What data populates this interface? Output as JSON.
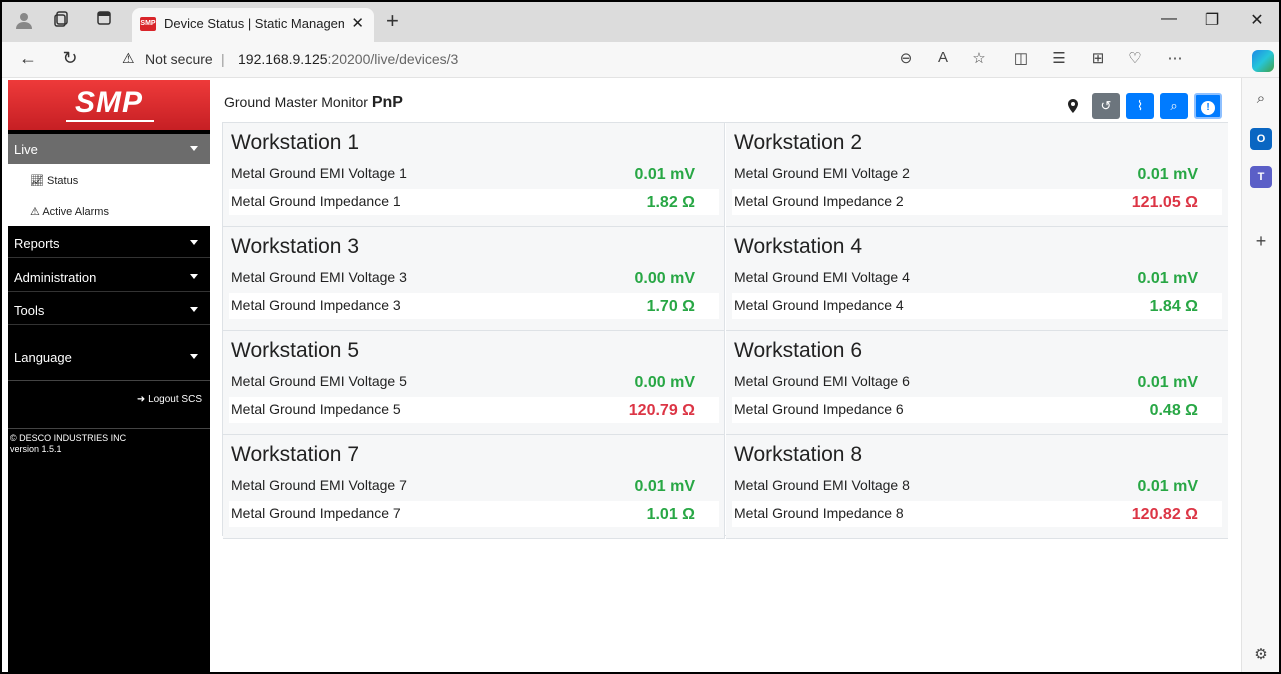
{
  "browser": {
    "tab_title": "Device Status | Static Managemen",
    "tab_close": "✕",
    "new_tab": "+",
    "not_secure": "Not secure",
    "url_host": "192.168.9.125",
    "url_path": ":20200/live/devices/3",
    "window_controls": [
      "—",
      "❐",
      "✕"
    ]
  },
  "sidebar": {
    "logo": "SMP",
    "live_label": "Live",
    "sub_items": [
      "Status",
      "Active Alarms"
    ],
    "menu_items": [
      "Reports",
      "Administration",
      "Tools",
      "Language"
    ],
    "logout": "Logout SCS",
    "copyright": "© DESCO INDUSTRIES INC",
    "version": "version 1.5.1"
  },
  "header": {
    "title": "Ground Master Monitor",
    "title_bold": "PnP"
  },
  "workstations": [
    {
      "title": "Workstation 1",
      "emi_label": "Metal Ground EMI Voltage 1",
      "emi_value": "0.01 mV",
      "emi_status": "ok",
      "imp_label": "Metal Ground Impedance 1",
      "imp_value": "1.82 Ω",
      "imp_status": "ok"
    },
    {
      "title": "Workstation 2",
      "emi_label": "Metal Ground EMI Voltage 2",
      "emi_value": "0.01 mV",
      "emi_status": "ok",
      "imp_label": "Metal Ground Impedance 2",
      "imp_value": "121.05 Ω",
      "imp_status": "alarm"
    },
    {
      "title": "Workstation 3",
      "emi_label": "Metal Ground EMI Voltage 3",
      "emi_value": "0.00 mV",
      "emi_status": "ok",
      "imp_label": "Metal Ground Impedance 3",
      "imp_value": "1.70 Ω",
      "imp_status": "ok"
    },
    {
      "title": "Workstation 4",
      "emi_label": "Metal Ground EMI Voltage 4",
      "emi_value": "0.01 mV",
      "emi_status": "ok",
      "imp_label": "Metal Ground Impedance 4",
      "imp_value": "1.84 Ω",
      "imp_status": "ok"
    },
    {
      "title": "Workstation 5",
      "emi_label": "Metal Ground EMI Voltage 5",
      "emi_value": "0.00 mV",
      "emi_status": "ok",
      "imp_label": "Metal Ground Impedance 5",
      "imp_value": "120.79 Ω",
      "imp_status": "alarm"
    },
    {
      "title": "Workstation 6",
      "emi_label": "Metal Ground EMI Voltage 6",
      "emi_value": "0.01 mV",
      "emi_status": "ok",
      "imp_label": "Metal Ground Impedance 6",
      "imp_value": "0.48 Ω",
      "imp_status": "ok"
    },
    {
      "title": "Workstation 7",
      "emi_label": "Metal Ground EMI Voltage 7",
      "emi_value": "0.01 mV",
      "emi_status": "ok",
      "imp_label": "Metal Ground Impedance 7",
      "imp_value": "1.01 Ω",
      "imp_status": "ok"
    },
    {
      "title": "Workstation 8",
      "emi_label": "Metal Ground EMI Voltage 8",
      "emi_value": "0.01 mV",
      "emi_status": "ok",
      "imp_label": "Metal Ground Impedance 8",
      "imp_value": "120.82 Ω",
      "imp_status": "alarm"
    }
  ],
  "colors": {
    "ok": "#28a745",
    "alarm": "#dc3545",
    "brand": "#d9252a",
    "primary": "#007bff",
    "secondary": "#6c757d"
  }
}
